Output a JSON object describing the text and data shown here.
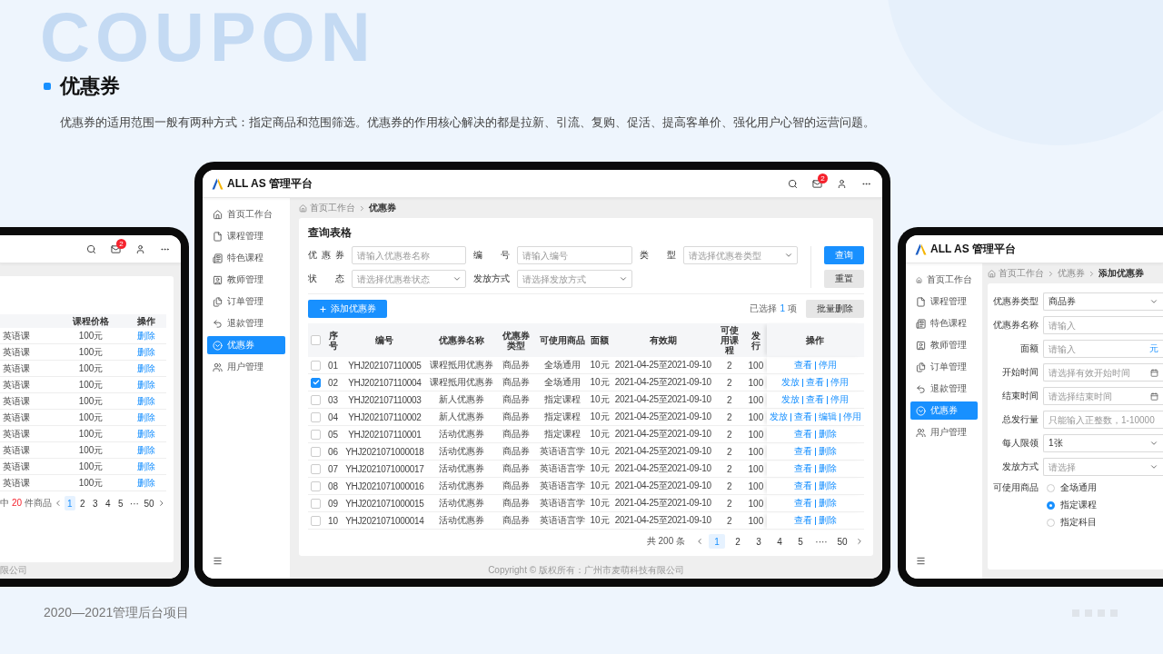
{
  "slide": {
    "background_word": "COUPON",
    "title": "优惠券",
    "description": "优惠券的适用范围一般有两种方式：指定商品和范围筛选。优惠券的作用核心解决的都是拉新、引流、复购、促活、提高客单价、强化用户心智的运营问题。",
    "footer": "2020—2021管理后台项目"
  },
  "left_screen": {
    "badge": "2",
    "table": {
      "columns": [
        "课程价格",
        "操作"
      ],
      "rows": [
        {
          "column_1": "英语课",
          "price": "100元",
          "action": "删除"
        },
        {
          "column_1": "英语课",
          "price": "100元",
          "action": "删除"
        },
        {
          "column_1": "英语课",
          "price": "100元",
          "action": "删除"
        },
        {
          "column_1": "英语课",
          "price": "100元",
          "action": "删除"
        },
        {
          "column_1": "英语课",
          "price": "100元",
          "action": "删除"
        },
        {
          "column_1": "英语课",
          "price": "100元",
          "action": "删除"
        },
        {
          "column_1": "英语课",
          "price": "100元",
          "action": "删除"
        },
        {
          "column_1": "英语课",
          "price": "100元",
          "action": "删除"
        },
        {
          "column_1": "英语课",
          "price": "100元",
          "action": "删除"
        },
        {
          "column_1": "英语课",
          "price": "100元",
          "action": "删除"
        }
      ]
    },
    "selection": {
      "prefix": "中",
      "count": "20",
      "suffix": "件商品"
    },
    "pages": [
      {
        "label": "1",
        "selected": true
      },
      {
        "label": "2",
        "selected": false
      },
      {
        "label": "3",
        "selected": false
      },
      {
        "label": "4",
        "selected": false
      },
      {
        "label": "5",
        "selected": false
      },
      {
        "label": "···",
        "selected": false
      },
      {
        "label": "50",
        "selected": false
      }
    ],
    "copyright": "限公司"
  },
  "main_screen": {
    "logo": "ALL AS 管理平台",
    "badge": "2",
    "sidebar": [
      {
        "label": "首页工作台",
        "selected": false
      },
      {
        "label": "课程管理",
        "selected": false
      },
      {
        "label": "特色课程",
        "selected": false
      },
      {
        "label": "教师管理",
        "selected": false
      },
      {
        "label": "订单管理",
        "selected": false
      },
      {
        "label": "退款管理",
        "selected": false
      },
      {
        "label": "优惠券",
        "selected": true
      },
      {
        "label": "用户管理",
        "selected": false
      }
    ],
    "breadcrumb": [
      "首页工作台",
      "优惠券"
    ],
    "query": {
      "title": "查询表格",
      "filters": [
        {
          "label": "优惠券",
          "kind": "input",
          "placeholder": "请输入优惠卷名称"
        },
        {
          "label": "编号",
          "kind": "input",
          "placeholder": "请输入编号"
        },
        {
          "label": "类型",
          "kind": "select",
          "placeholder": "请选择优惠卷类型"
        },
        {
          "label": "状态",
          "kind": "select",
          "placeholder": "请选择优惠卷状态"
        },
        {
          "label": "发放方式",
          "kind": "select",
          "placeholder": "请选择发放方式"
        }
      ],
      "search_button": "查询",
      "reset_button": "重置"
    },
    "add_button": "添加优惠券",
    "selection": {
      "prefix": "已选择",
      "count": "1",
      "suffix": "项"
    },
    "bulk_delete_button": "批量删除",
    "table": {
      "select_all_checked": false,
      "columns": [
        "序号",
        "编号",
        "优惠券名称",
        "优惠券类型",
        "可使用商品",
        "面额",
        "有效期",
        "可使用课程",
        "发行",
        "操作"
      ],
      "rows": [
        {
          "checked": false,
          "cells": [
            "01",
            "YHJ202107110005",
            "课程抵用优惠券",
            "商品券",
            "全场通用",
            "10元",
            "2021-04-25至2021-09-10",
            "2",
            "100"
          ],
          "actions": [
            "查看",
            "停用"
          ]
        },
        {
          "checked": true,
          "cells": [
            "02",
            "YHJ202107110004",
            "课程抵用优惠券",
            "商品券",
            "全场通用",
            "10元",
            "2021-04-25至2021-09-10",
            "2",
            "100"
          ],
          "actions": [
            "发放",
            "查看",
            "停用"
          ]
        },
        {
          "checked": false,
          "cells": [
            "03",
            "YHJ202107110003",
            "新人优惠券",
            "商品券",
            "指定课程",
            "10元",
            "2021-04-25至2021-09-10",
            "2",
            "100"
          ],
          "actions": [
            "发放",
            "查看",
            "停用"
          ]
        },
        {
          "checked": false,
          "cells": [
            "04",
            "YHJ202107110002",
            "新人优惠券",
            "商品券",
            "指定课程",
            "10元",
            "2021-04-25至2021-09-10",
            "2",
            "100"
          ],
          "actions": [
            "发放",
            "查看",
            "编辑",
            "停用"
          ]
        },
        {
          "checked": false,
          "cells": [
            "05",
            "YHJ202107110001",
            "活动优惠券",
            "商品券",
            "指定课程",
            "10元",
            "2021-04-25至2021-09-10",
            "2",
            "100"
          ],
          "actions": [
            "查看",
            "删除"
          ]
        },
        {
          "checked": false,
          "cells": [
            "06",
            "YHJ2021071000018",
            "活动优惠券",
            "商品券",
            "英语语言学",
            "10元",
            "2021-04-25至2021-09-10",
            "2",
            "100"
          ],
          "actions": [
            "查看",
            "删除"
          ]
        },
        {
          "checked": false,
          "cells": [
            "07",
            "YHJ2021071000017",
            "活动优惠券",
            "商品券",
            "英语语言学",
            "10元",
            "2021-04-25至2021-09-10",
            "2",
            "100"
          ],
          "actions": [
            "查看",
            "删除"
          ]
        },
        {
          "checked": false,
          "cells": [
            "08",
            "YHJ2021071000016",
            "活动优惠券",
            "商品券",
            "英语语言学",
            "10元",
            "2021-04-25至2021-09-10",
            "2",
            "100"
          ],
          "actions": [
            "查看",
            "删除"
          ]
        },
        {
          "checked": false,
          "cells": [
            "09",
            "YHJ2021071000015",
            "活动优惠券",
            "商品券",
            "英语语言学",
            "10元",
            "2021-04-25至2021-09-10",
            "2",
            "100"
          ],
          "actions": [
            "查看",
            "删除"
          ]
        },
        {
          "checked": false,
          "cells": [
            "10",
            "YHJ2021071000014",
            "活动优惠券",
            "商品券",
            "英语语言学",
            "10元",
            "2021-04-25至2021-09-10",
            "2",
            "100"
          ],
          "actions": [
            "查看",
            "删除"
          ]
        }
      ]
    },
    "total": "共 200 条",
    "pages": [
      {
        "label": "1",
        "selected": true
      },
      {
        "label": "2",
        "selected": false
      },
      {
        "label": "3",
        "selected": false
      },
      {
        "label": "4",
        "selected": false
      },
      {
        "label": "5",
        "selected": false
      },
      {
        "label": "····",
        "selected": false
      },
      {
        "label": "50",
        "selected": false
      }
    ],
    "copyright": "Copyright © 版权所有：广州市麦萌科技有限公司"
  },
  "form_screen": {
    "logo": "ALL AS 管理平台",
    "sidebar": [
      {
        "label": "首页工作台",
        "selected": false
      },
      {
        "label": "课程管理",
        "selected": false
      },
      {
        "label": "特色课程",
        "selected": false
      },
      {
        "label": "教师管理",
        "selected": false
      },
      {
        "label": "订单管理",
        "selected": false
      },
      {
        "label": "退款管理",
        "selected": false
      },
      {
        "label": "优惠券",
        "selected": true
      },
      {
        "label": "用户管理",
        "selected": false
      }
    ],
    "breadcrumb": [
      "首页工作台",
      "优惠券",
      "添加优惠券"
    ],
    "fields": [
      {
        "label": "优惠券类型",
        "kind": "select",
        "value": "商品券"
      },
      {
        "label": "优惠券名称",
        "kind": "input",
        "placeholder": "请输入"
      },
      {
        "label": "面额",
        "kind": "input",
        "placeholder": "请输入",
        "suffix": "元"
      },
      {
        "label": "开始时间",
        "kind": "date",
        "placeholder": "请选择有效开始时间"
      },
      {
        "label": "结束时间",
        "kind": "date",
        "placeholder": "请选择结束时间"
      },
      {
        "label": "总发行量",
        "kind": "input",
        "placeholder": "只能输入正整数，1-10000"
      },
      {
        "label": "每人限领",
        "kind": "select",
        "value": "1张"
      },
      {
        "label": "发放方式",
        "kind": "select",
        "placeholder": "请选择"
      }
    ],
    "goods": {
      "label": "可使用商品",
      "options": [
        {
          "label": "全场通用",
          "selected": false
        },
        {
          "label": "指定课程",
          "selected": true
        },
        {
          "label": "指定科目",
          "selected": false
        }
      ]
    }
  }
}
